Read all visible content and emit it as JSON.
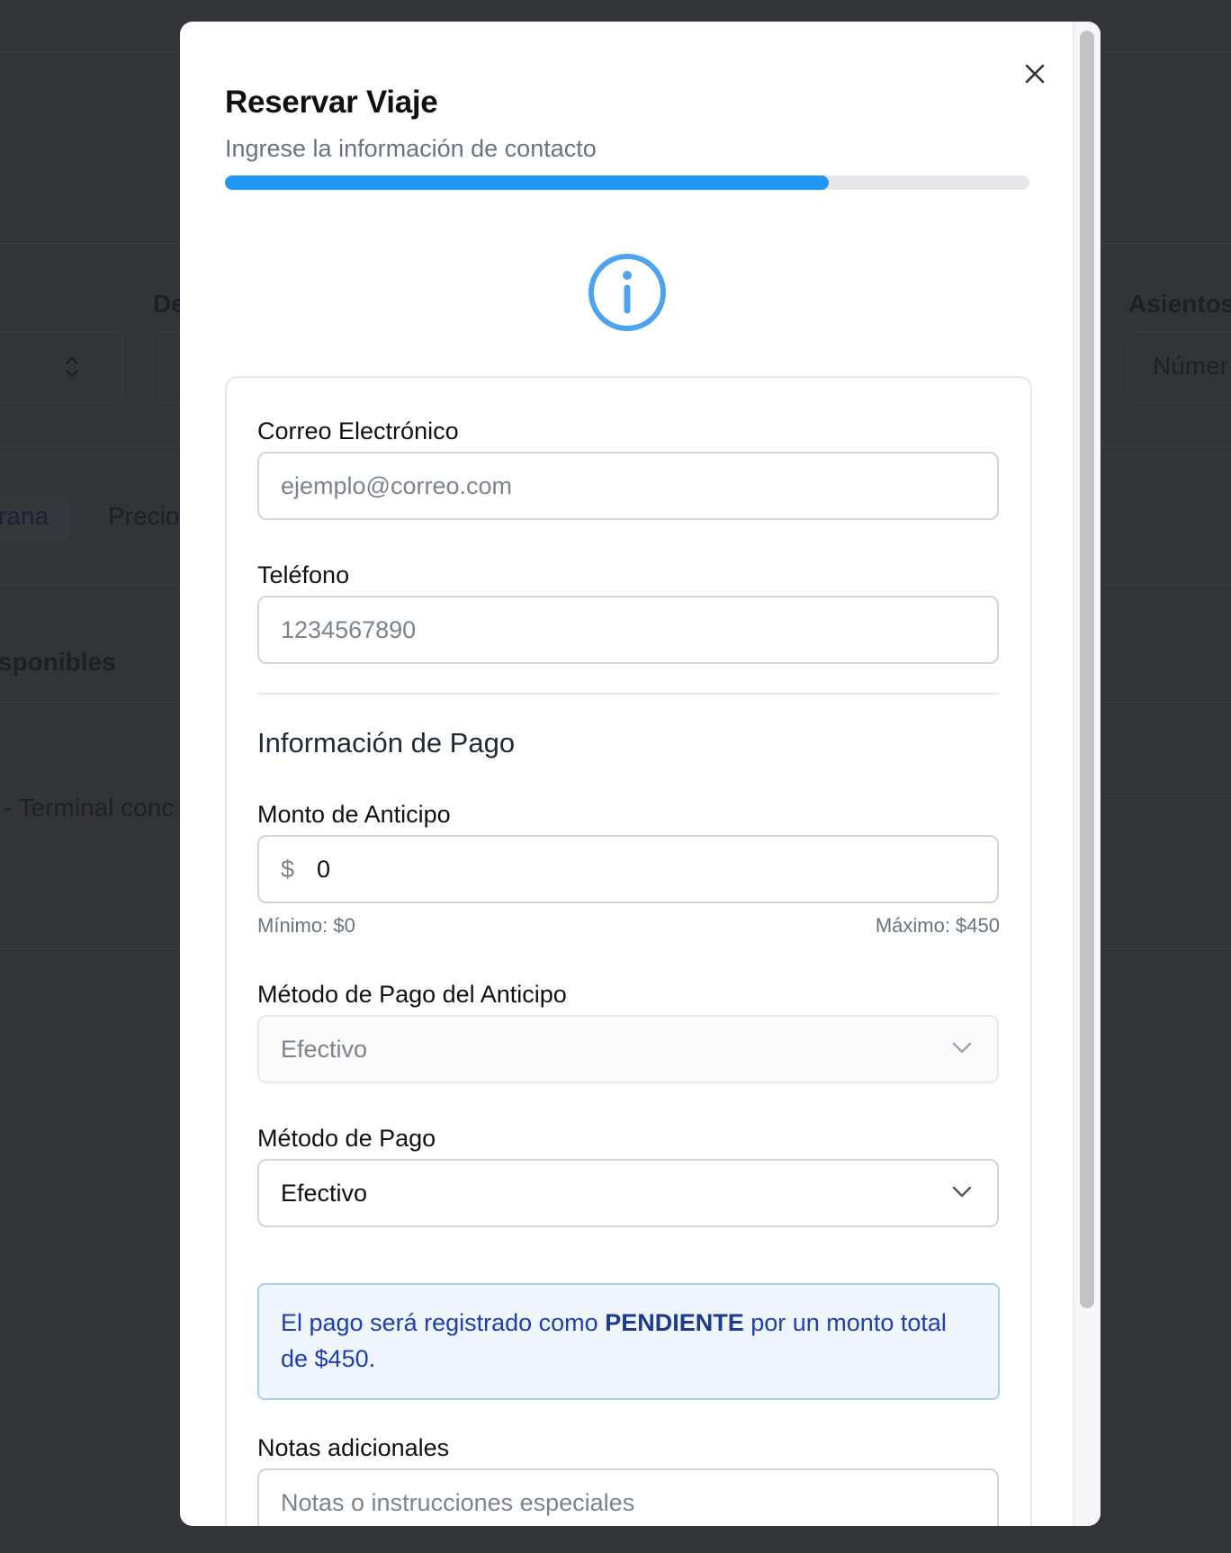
{
  "background": {
    "filter_label_destino": "De",
    "filter_label_asientos": "Asientos",
    "asientos_placeholder": "Númer",
    "tab_active": "rana",
    "tab_precio": "Precio",
    "list_heading": "sponibles",
    "route_text": "- Terminal conc"
  },
  "modal": {
    "title": "Reservar Viaje",
    "subtitle": "Ingrese la información de contacto",
    "progress_percent": 75,
    "accent_color": "#2196f3",
    "close_icon": "close-icon",
    "status_icon": "info-circle-icon"
  },
  "form": {
    "email": {
      "label": "Correo Electrónico",
      "placeholder": "ejemplo@correo.com",
      "value": ""
    },
    "phone": {
      "label": "Teléfono",
      "placeholder": "1234567890",
      "value": ""
    },
    "payment_section_title": "Información de Pago",
    "deposit": {
      "label": "Monto de Anticipo",
      "currency": "$",
      "value": "0",
      "min_hint": "Mínimo: $0",
      "max_hint": "Máximo: $450"
    },
    "deposit_method": {
      "label": "Método de Pago del Anticipo",
      "selected": "Efectivo",
      "disabled": true
    },
    "payment_method": {
      "label": "Método de Pago",
      "selected": "Efectivo"
    },
    "alert": {
      "prefix": "El pago será registrado como ",
      "status": "PENDIENTE",
      "suffix": " por un monto total de $450."
    },
    "notes": {
      "label": "Notas adicionales",
      "placeholder": "Notas o instrucciones especiales"
    }
  }
}
